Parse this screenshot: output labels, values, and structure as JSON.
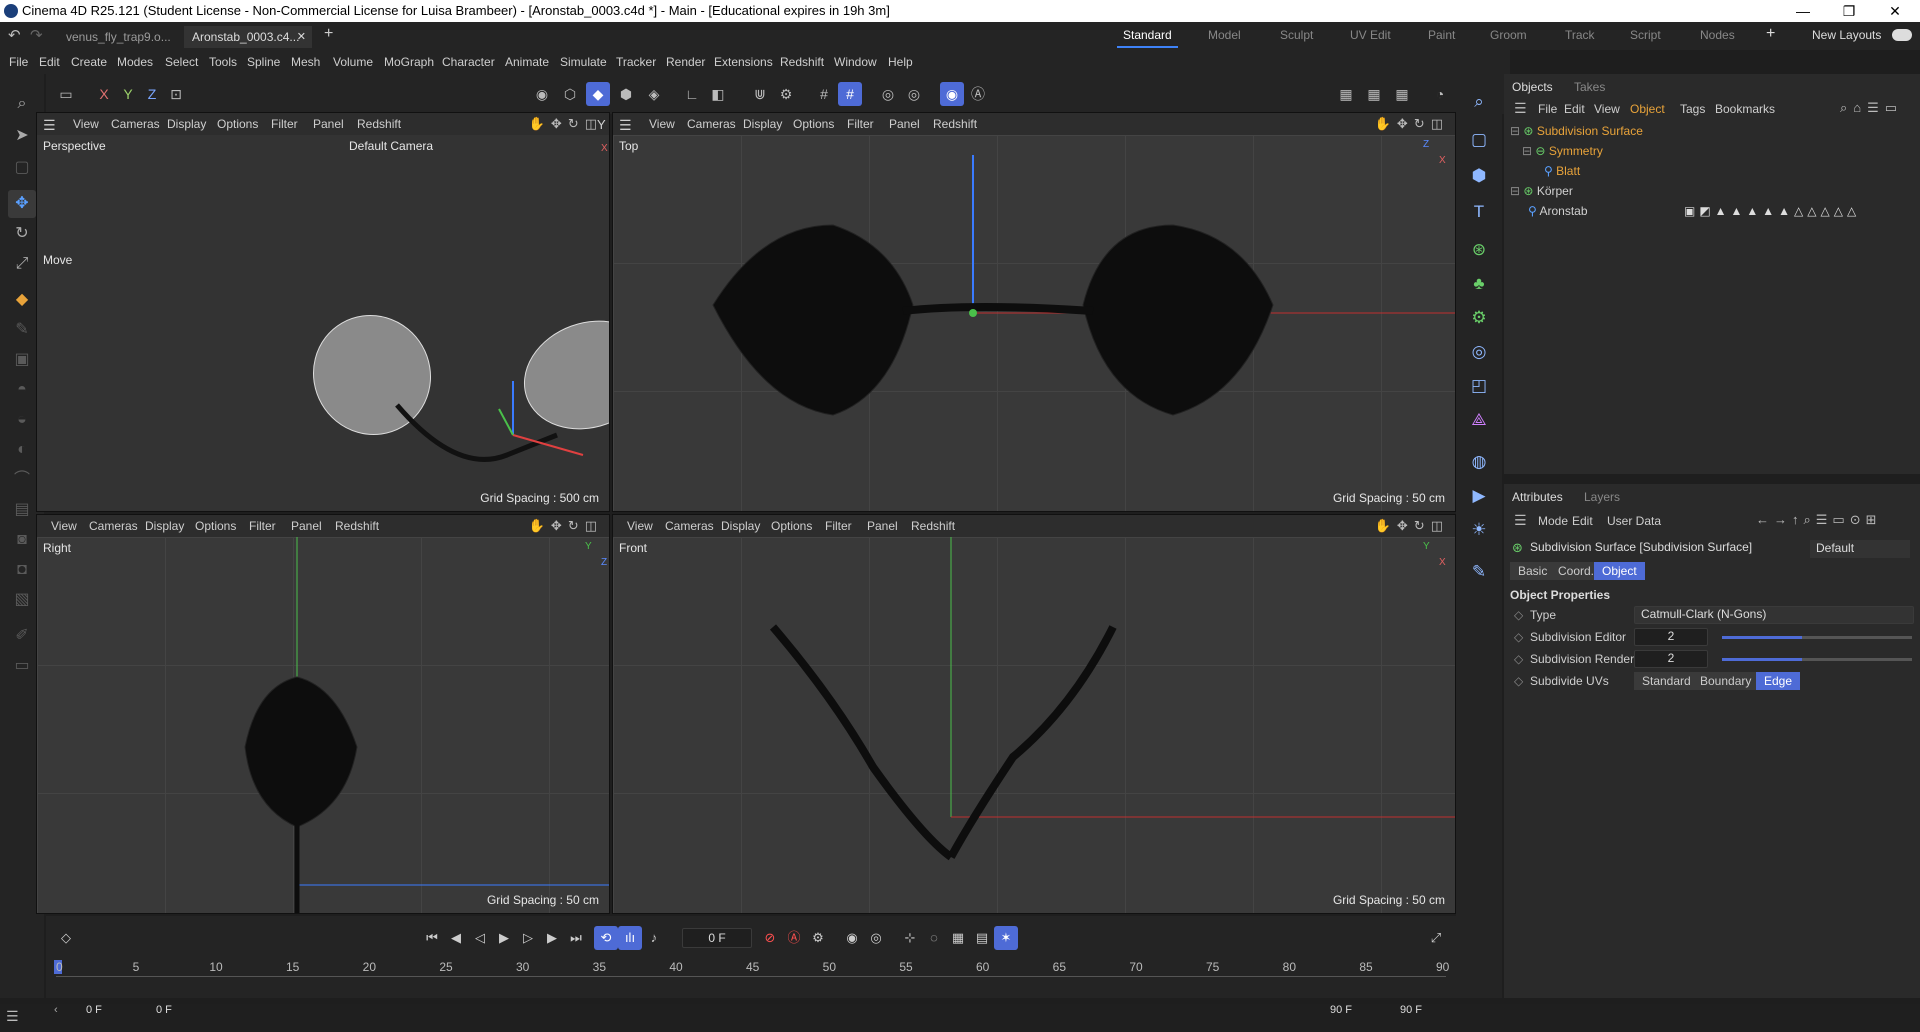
{
  "window": {
    "title": "Cinema 4D R25.121 (Student License - Non-Commercial License for Luisa Brambeer) - [Aronstab_0003.c4d *] - Main - [Educational expires in 19h 3m]",
    "minimize": "—",
    "maximize": "❐",
    "close": "✕"
  },
  "doc_tabs": [
    {
      "label": "venus_fly_trap9.o..."
    },
    {
      "label": "Aronstab_0003.c4..."
    }
  ],
  "tab_close": "✕",
  "tab_add": "+",
  "layouts": [
    "Standard",
    "Model",
    "Sculpt",
    "UV Edit",
    "Paint",
    "Groom",
    "Track",
    "Script",
    "Nodes"
  ],
  "layout_add": "+",
  "new_layouts": "New Layouts",
  "menus": [
    "File",
    "Edit",
    "Create",
    "Modes",
    "Select",
    "Tools",
    "Spline",
    "Mesh",
    "Volume",
    "MoGraph",
    "Character",
    "Animate",
    "Simulate",
    "Tracker",
    "Render",
    "Extensions",
    "Redshift",
    "Window",
    "Help"
  ],
  "axis_buttons": [
    "X",
    "Y",
    "Z"
  ],
  "viewport_menu": [
    "View",
    "Cameras",
    "Display",
    "Options",
    "Filter",
    "Panel",
    "Redshift"
  ],
  "viewports": [
    {
      "name": "Perspective",
      "camera": "Default Camera",
      "grid": "Grid Spacing : 500 cm",
      "axis_a": "Y",
      "axis_b": "X"
    },
    {
      "name": "Top",
      "camera": "",
      "grid": "Grid Spacing : 50 cm",
      "axis_a": "Z",
      "axis_b": "X"
    },
    {
      "name": "Right",
      "camera": "",
      "grid": "Grid Spacing : 50 cm",
      "axis_a": "Y",
      "axis_b": "Z"
    },
    {
      "name": "Front",
      "camera": "",
      "grid": "Grid Spacing : 50 cm",
      "axis_a": "Y",
      "axis_b": "X"
    }
  ],
  "move_label": "Move",
  "objects_panel": {
    "tabs": [
      "Objects",
      "Takes"
    ],
    "menu": [
      "File",
      "Edit",
      "View",
      "Object",
      "Tags",
      "Bookmarks"
    ],
    "items": [
      {
        "name": "Subdivision Surface",
        "color": "#e8a33a"
      },
      {
        "name": "Symmetry",
        "color": "#e8a33a"
      },
      {
        "name": "Blatt",
        "color": "#e8a33a"
      },
      {
        "name": "Körper",
        "color": "#d0d0d0"
      },
      {
        "name": "Aronstab",
        "color": "#d0d0d0"
      }
    ]
  },
  "attributes_panel": {
    "tabs": [
      "Attributes",
      "Layers"
    ],
    "menu": [
      "Mode",
      "Edit",
      "User Data"
    ],
    "object_title": "Subdivision Surface [Subdivision Surface]",
    "preset": "Default",
    "sub_tabs": [
      "Basic",
      "Coord.",
      "Object"
    ],
    "section": "Object Properties",
    "type_label": "Type",
    "type_value": "Catmull-Clark (N-Gons)",
    "sub_editor_label": "Subdivision Editor",
    "sub_editor_value": "2",
    "sub_renderer_label": "Subdivision Renderer",
    "sub_renderer_value": "2",
    "subdivide_uvs_label": "Subdivide UVs",
    "uv_options": [
      "Standard",
      "Boundary",
      "Edge"
    ]
  },
  "timeline": {
    "current_frame": "0 F",
    "ticks": [
      "0",
      "5",
      "10",
      "15",
      "20",
      "25",
      "30",
      "35",
      "40",
      "45",
      "50",
      "55",
      "60",
      "65",
      "70",
      "75",
      "80",
      "85",
      "90"
    ],
    "start": "0 F",
    "start2": "0 F",
    "end": "90 F",
    "end2": "90 F"
  },
  "accent": "#4e6bd6"
}
